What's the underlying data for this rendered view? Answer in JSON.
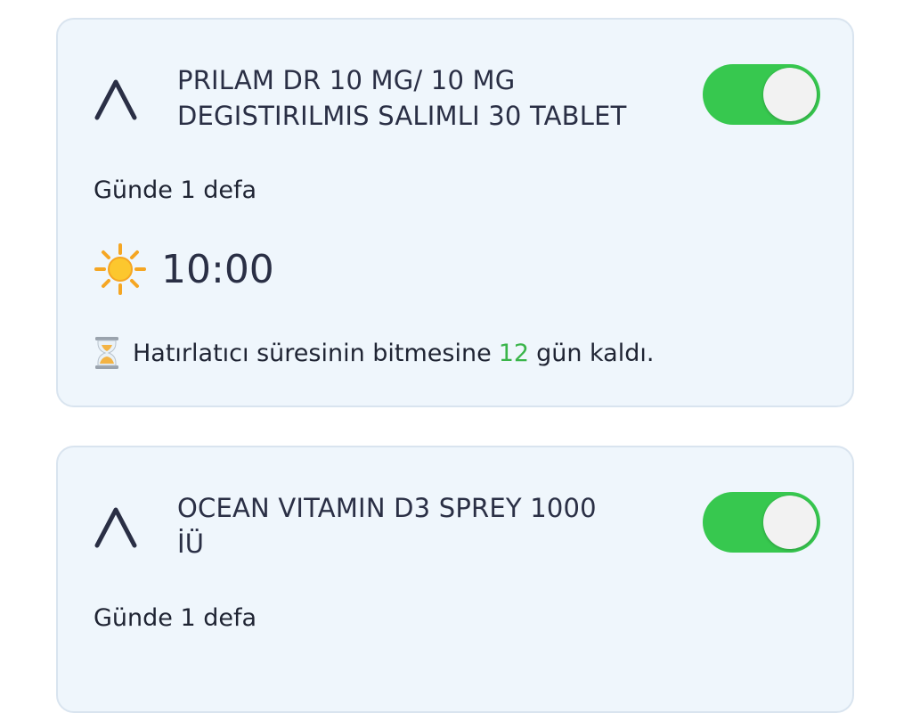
{
  "cards": [
    {
      "name_line1": "PRILAM DR 10 MG/ 10 MG",
      "name_line2": "DEGISTIRILMIS SALIMLI 30 TABLET",
      "toggle_on": true,
      "frequency": "Günde 1 defa",
      "time_icon": "sun-icon",
      "time": "10:00",
      "reminder_icon": "hourglass-icon",
      "reminder_prefix": "Hatırlatıcı süresinin bitmesine",
      "reminder_days": "12",
      "reminder_suffix": "gün kaldı."
    },
    {
      "name_line1": "OCEAN VITAMIN D3 SPREY 1000",
      "name_line2": "İÜ",
      "toggle_on": true,
      "frequency": "Günde 1 defa"
    }
  ],
  "colors": {
    "card_background": "#eff6fc",
    "card_border": "#d9e4ef",
    "toggle_on": "#37c84f",
    "days_highlight": "#3ab54a",
    "text_primary": "#2a2f45"
  }
}
